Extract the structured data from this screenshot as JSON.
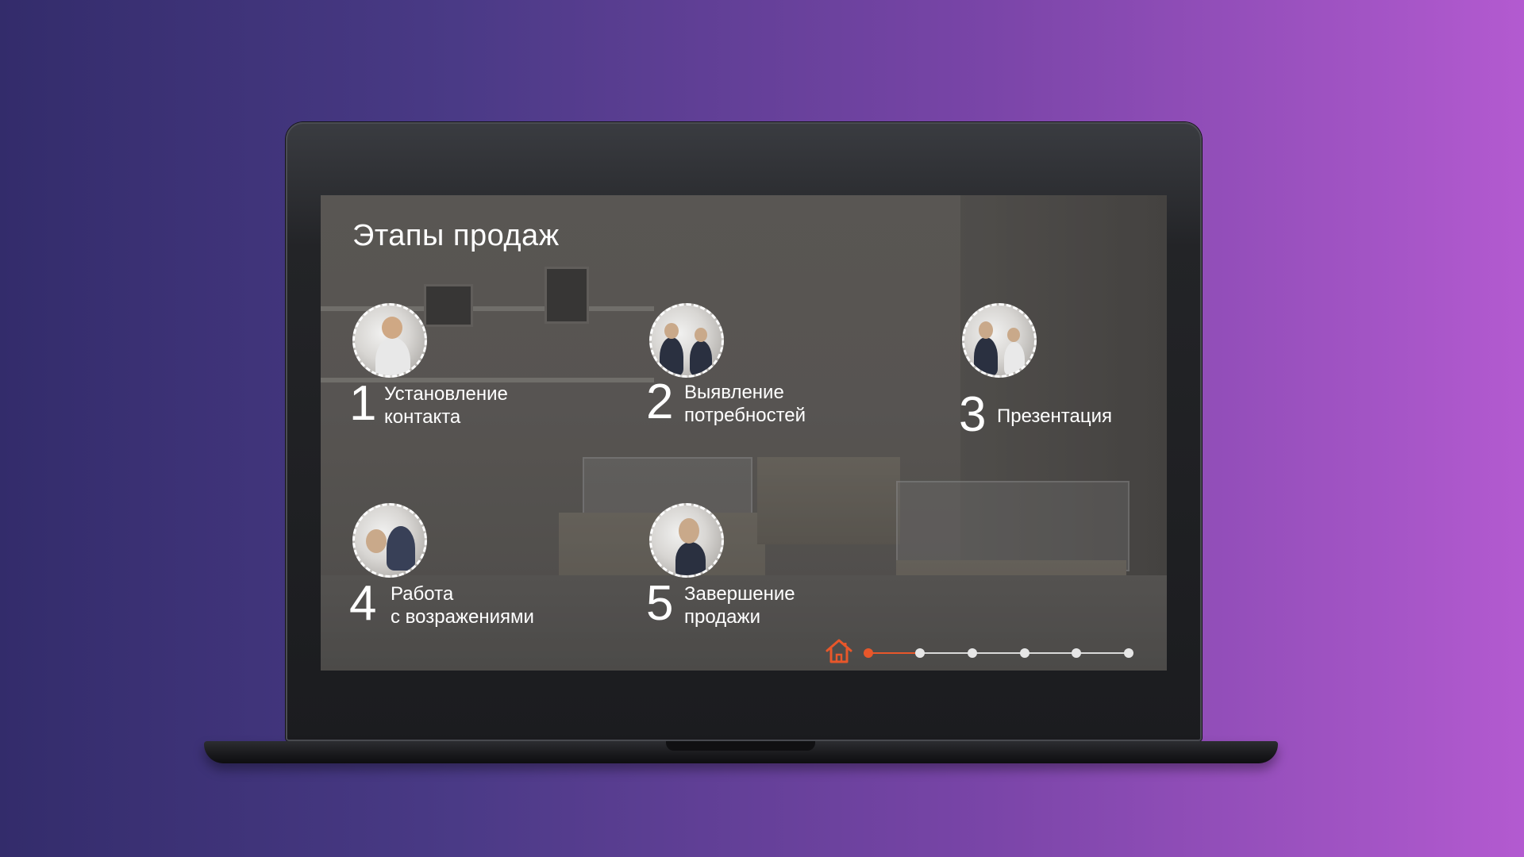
{
  "slide": {
    "title": "Этапы продаж"
  },
  "steps": [
    {
      "number": "1",
      "line1": "Установление",
      "line2": "контакта"
    },
    {
      "number": "2",
      "line1": "Выявление",
      "line2": "потребностей"
    },
    {
      "number": "3",
      "line1": "Презентация",
      "line2": ""
    },
    {
      "number": "4",
      "line1": "Работа",
      "line2": "с возражениями"
    },
    {
      "number": "5",
      "line1": "Завершение",
      "line2": "продажи"
    }
  ],
  "navigation": {
    "home_icon": "home-icon",
    "dot_count": 6,
    "active_index": 0,
    "accent_color": "#e8572a"
  }
}
